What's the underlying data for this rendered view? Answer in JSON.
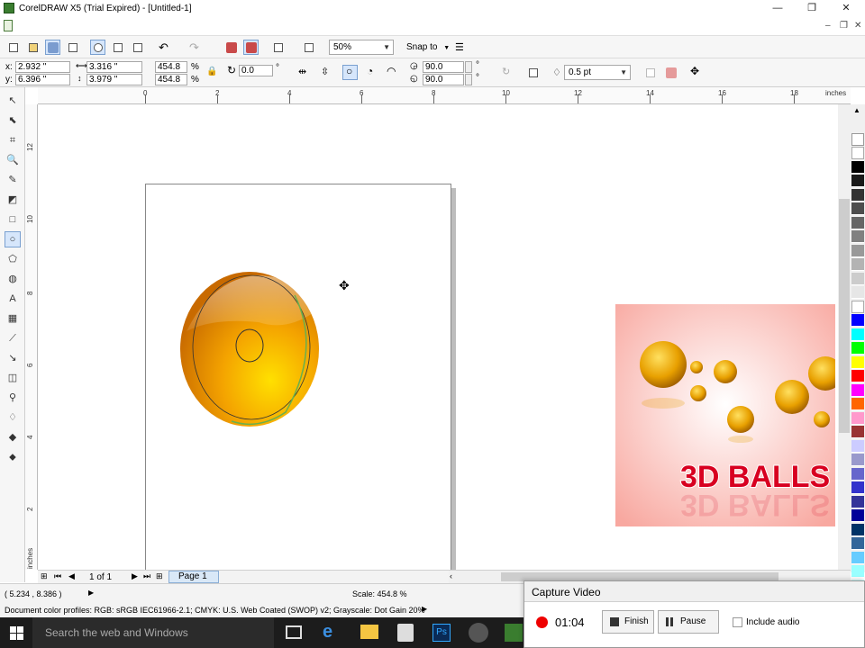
{
  "window": {
    "title": "CorelDRAW X5 (Trial Expired) - [Untitled-1]"
  },
  "toolbar": {
    "zoom_value": "50%",
    "snap_to_label": "Snap to"
  },
  "properties": {
    "x_label": "x:",
    "x_value": "2.932 \"",
    "y_label": "y:",
    "y_value": "6.396 \"",
    "width_value": "3.316 \"",
    "height_value": "3.979 \"",
    "scale_x": "454.8",
    "scale_y": "454.8",
    "percent": "%",
    "rotation": "0.0",
    "degree": "°",
    "start_angle": "90.0",
    "end_angle": "90.0",
    "outline_width": "0.5 pt"
  },
  "ruler": {
    "units": "inches",
    "h_numbers": [
      "0",
      "2",
      "4",
      "6",
      "8",
      "10",
      "12",
      "14",
      "16",
      "18"
    ],
    "v_numbers": [
      "12",
      "10",
      "8",
      "6",
      "4",
      "2"
    ],
    "v_units": "inches"
  },
  "page_nav": {
    "page_count": "1 of 1",
    "page_tab": "Page 1"
  },
  "status": {
    "coordinates": "( 5.234 , 8.386 )",
    "scale": "Scale: 454.8 %",
    "color_profiles": "Document color profiles: RGB: sRGB IEC61966-2.1; CMYK: U.S. Web Coated (SWOP) v2; Grayscale: Dot Gain 20%"
  },
  "preview_image": {
    "text": "3D BALLS"
  },
  "taskbar": {
    "search_placeholder": "Search the web and Windows",
    "photoshop_label": "Ps"
  },
  "capture": {
    "title": "Capture Video",
    "time": "01:04",
    "finish_label": "Finish",
    "pause_label": "Pause",
    "audio_label": "Include audio"
  },
  "palette_colors": [
    "#ffffff",
    "#000000",
    "#1a1a1a",
    "#333333",
    "#4d4d4d",
    "#666666",
    "#808080",
    "#999999",
    "#b3b3b3",
    "#cccccc",
    "#e6e6e6",
    "#ffffff",
    "#0000ff",
    "#00ffff",
    "#00ff00",
    "#ffff00",
    "#ff0000",
    "#ff00ff",
    "#ff6600",
    "#ff99cc",
    "#993333",
    "#ccccff",
    "#9999cc",
    "#6666cc",
    "#3333cc",
    "#333399",
    "#000099",
    "#003366",
    "#336699",
    "#66ccff",
    "#99ffff",
    "#ccffff"
  ]
}
